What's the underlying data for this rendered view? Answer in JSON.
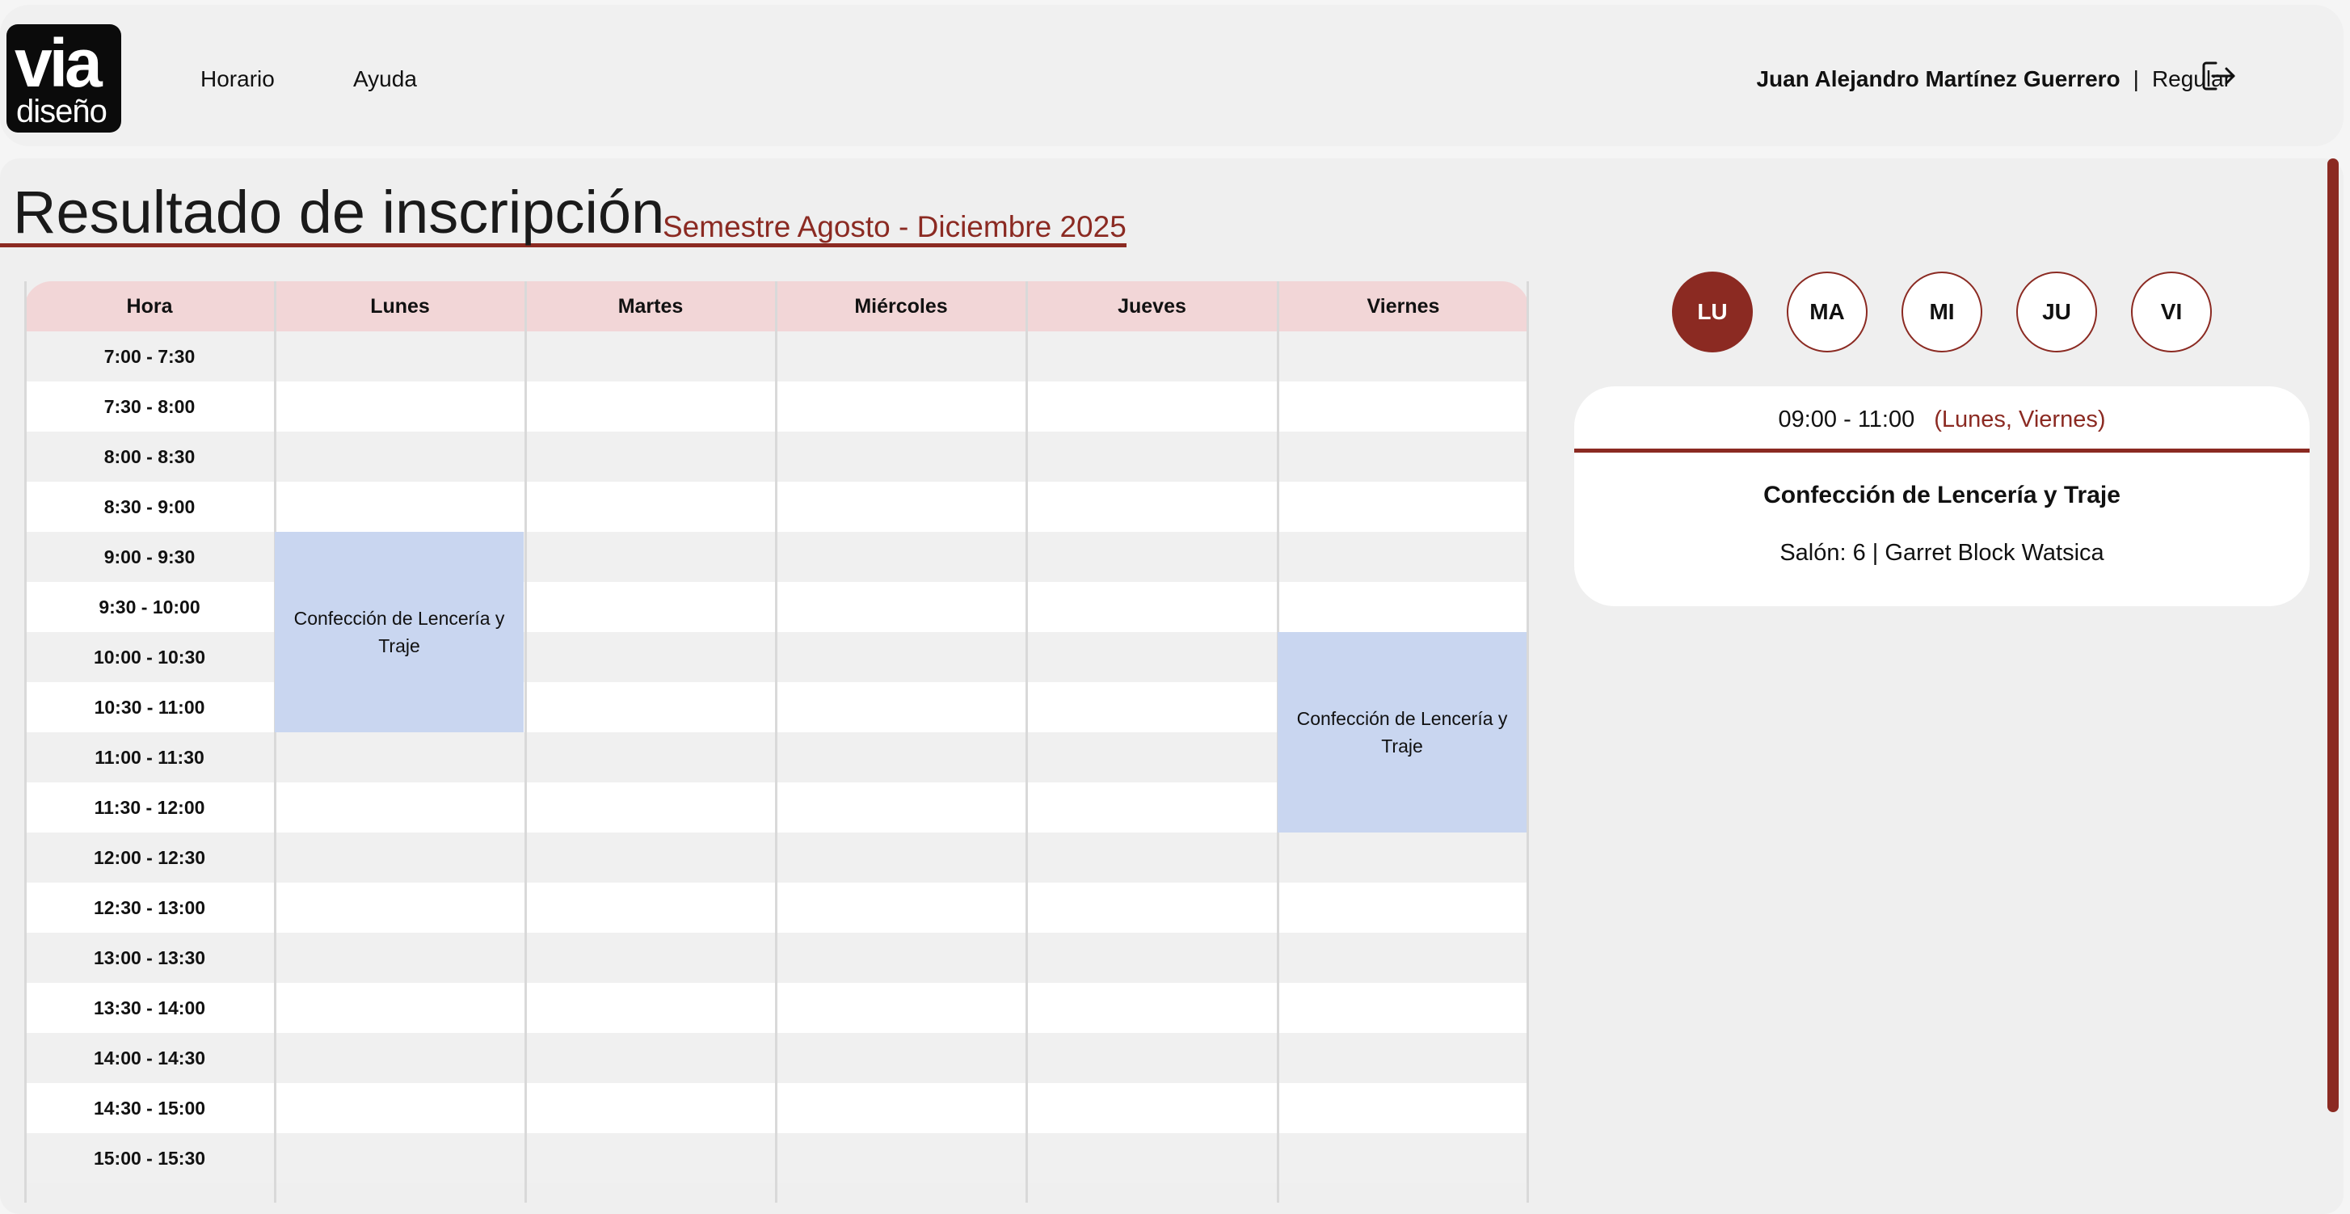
{
  "logo": {
    "line1": "via",
    "line2": "diseño"
  },
  "nav": {
    "horario": "Horario",
    "ayuda": "Ayuda"
  },
  "user": {
    "name": "Juan Alejandro Martínez Guerrero",
    "separator": "|",
    "role": "Regular"
  },
  "icons": {
    "logout": "logout-icon"
  },
  "page": {
    "title": "Resultado de inscripción",
    "semester": "Semestre Agosto - Diciembre 2025"
  },
  "schedule": {
    "headers": [
      "Hora",
      "Lunes",
      "Martes",
      "Miércoles",
      "Jueves",
      "Viernes"
    ],
    "times": [
      "7:00 - 7:30",
      "7:30 - 8:00",
      "8:00 - 8:30",
      "8:30 - 9:00",
      "9:00 - 9:30",
      "9:30 - 10:00",
      "10:00 - 10:30",
      "10:30 - 11:00",
      "11:00 - 11:30",
      "11:30 - 12:00",
      "12:00 - 12:30",
      "12:30 - 13:00",
      "13:00 - 13:30",
      "13:30 - 14:00",
      "14:00 - 14:30",
      "14:30 - 15:00",
      "15:00 - 15:30"
    ],
    "classes": [
      {
        "label": "Confección de Lencería y Traje",
        "day": "Lunes",
        "start": "9:00",
        "end": "11:00"
      },
      {
        "label": "Confección de Lencería y Traje",
        "day": "Viernes",
        "start": "10:00",
        "end": "12:00"
      }
    ]
  },
  "days": {
    "items": [
      "LU",
      "MA",
      "MI",
      "JU",
      "VI"
    ],
    "selected": "LU"
  },
  "detail": {
    "time": "09:00 - 11:00",
    "days_note": "(Lunes, Viernes)",
    "course": "Confección de Lencería y Traje",
    "room": "Salón: 6 | Garret Block Watsica"
  },
  "colors": {
    "accent": "#8b2a22",
    "header_row": "#f2d6d7",
    "class_block": "#c9d6f0"
  }
}
